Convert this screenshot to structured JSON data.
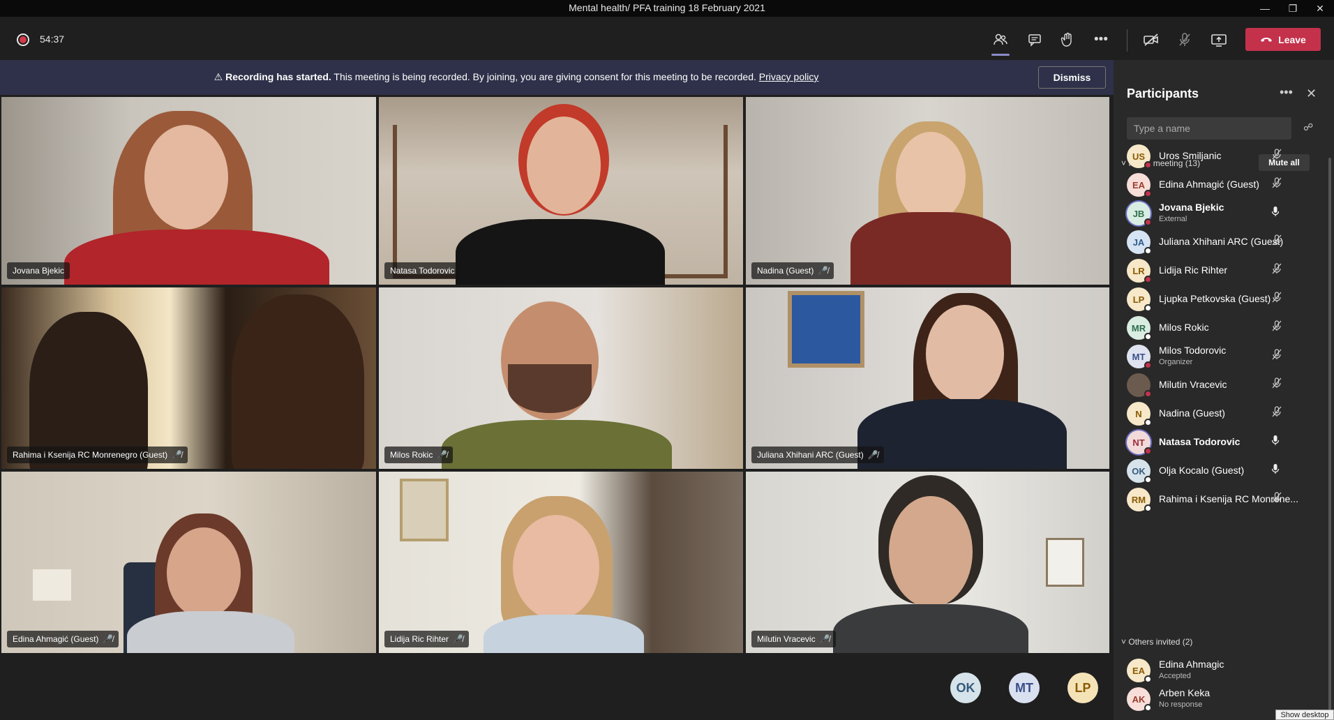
{
  "window": {
    "title": "Mental health/ PFA training 18 February 2021",
    "controls": [
      "minimize-icon",
      "restore-icon",
      "close-icon"
    ]
  },
  "toolbar": {
    "timer": "54:37",
    "icons": [
      "participants-icon",
      "chat-icon",
      "raise-hand-icon",
      "more-options-icon",
      "camera-off-icon",
      "mic-off-icon",
      "share-screen-icon"
    ],
    "leave_label": "Leave",
    "leave_color": "#c4314b"
  },
  "banner": {
    "bold_text": "Recording has started.",
    "message": "This meeting is being recorded. By joining, you are giving consent for this meeting to be recorded.",
    "link": "Privacy policy",
    "dismiss_label": "Dismiss"
  },
  "tiles": [
    {
      "name": "Jovana Bjekic",
      "muted": false
    },
    {
      "name": "Natasa Todorovic",
      "muted": false
    },
    {
      "name": "Nadina (Guest)",
      "muted": true
    },
    {
      "name": "Rahima i Ksenija RC Monrenegro (Guest)",
      "muted": true
    },
    {
      "name": "Milos Rokic",
      "muted": true
    },
    {
      "name": "Juliana Xhihani ARC (Guest)",
      "muted": true
    },
    {
      "name": "Edina Ahmagić (Guest)",
      "muted": true
    },
    {
      "name": "Lidija Ric Rihter",
      "muted": true
    },
    {
      "name": "Milutin Vracevic",
      "muted": true
    }
  ],
  "overflow_avatars": [
    {
      "initials": "OK",
      "bg": "#d6e3ea",
      "fg": "#35597a"
    },
    {
      "initials": "MT",
      "bg": "#d9e0f0",
      "fg": "#3a4f8a"
    },
    {
      "initials": "LP",
      "bg": "#f5e3b8",
      "fg": "#8a5a00"
    }
  ],
  "panel": {
    "title": "Participants",
    "search_placeholder": "Type a name",
    "in_meeting_label": "In this meeting (13)",
    "mute_all_label": "Mute all",
    "others_label": "Others invited (2)",
    "participants": [
      {
        "initials": "US",
        "name": "Uros Smiljanic",
        "sub": "",
        "mic": "off",
        "bold": false,
        "status": "#c4314b",
        "bg": "#f6e8c9",
        "fg": "#8a5a00"
      },
      {
        "initials": "EA",
        "name": "Edina Ahmagić (Guest)",
        "sub": "",
        "mic": "off",
        "bold": false,
        "status": "#c4314b",
        "bg": "#f7ded9",
        "fg": "#9a3b2c"
      },
      {
        "initials": "JB",
        "name": "Jovana Bjekic",
        "sub": "External",
        "mic": "on",
        "bold": true,
        "status": "#c4314b",
        "bg": "#d9ede3",
        "fg": "#2f6f4c"
      },
      {
        "initials": "JA",
        "name": "Juliana Xhihani ARC (Guest)",
        "sub": "",
        "mic": "off",
        "bold": false,
        "status": "#ffffff",
        "bg": "#d6e3f2",
        "fg": "#2f5a8a"
      },
      {
        "initials": "LR",
        "name": "Lidija Ric Rihter",
        "sub": "",
        "mic": "off",
        "bold": false,
        "status": "#c4314b",
        "bg": "#f6e8c9",
        "fg": "#8a5a00"
      },
      {
        "initials": "LP",
        "name": "Ljupka Petkovska (Guest)",
        "sub": "",
        "mic": "off",
        "bold": false,
        "status": "#ffffff",
        "bg": "#f6e8c9",
        "fg": "#8a5a00"
      },
      {
        "initials": "MR",
        "name": "Milos Rokic",
        "sub": "",
        "mic": "off",
        "bold": false,
        "status": "#ffffff",
        "bg": "#d9ede3",
        "fg": "#2f6f4c"
      },
      {
        "initials": "MT",
        "name": "Milos Todorovic",
        "sub": "Organizer",
        "mic": "off",
        "bold": false,
        "status": "#c4314b",
        "bg": "#dfe3f0",
        "fg": "#3a4f8a"
      },
      {
        "initials": "",
        "name": "Milutin Vracevic",
        "sub": "",
        "mic": "off",
        "bold": false,
        "status": "#c4314b",
        "bg": "#6b5a4e",
        "fg": "#ffffff"
      },
      {
        "initials": "N",
        "name": "Nadina (Guest)",
        "sub": "",
        "mic": "off",
        "bold": false,
        "status": "#ffffff",
        "bg": "#f6e8c9",
        "fg": "#8a5a00"
      },
      {
        "initials": "NT",
        "name": "Natasa Todorovic",
        "sub": "",
        "mic": "on",
        "bold": true,
        "status": "#c4314b",
        "bg": "#f2dada",
        "fg": "#9a2c3a"
      },
      {
        "initials": "OK",
        "name": "Olja Kocalo (Guest)",
        "sub": "",
        "mic": "on",
        "bold": false,
        "status": "#ffffff",
        "bg": "#d6e3ea",
        "fg": "#35597a"
      },
      {
        "initials": "RM",
        "name": "Rahima i Ksenija RC Monrene...",
        "sub": "",
        "mic": "off",
        "bold": false,
        "status": "#ffffff",
        "bg": "#f6e8c9",
        "fg": "#8a5a00"
      }
    ],
    "invited": [
      {
        "initials": "EA",
        "name": "Edina Ahmagic",
        "sub": "Accepted",
        "status": "#ffffff",
        "bg": "#f6e8c9",
        "fg": "#8a5a00"
      },
      {
        "initials": "AK",
        "name": "Arben Keka",
        "sub": "No response",
        "status": "#ffffff",
        "bg": "#f7ded9",
        "fg": "#9a3b2c"
      }
    ]
  },
  "tooltip": "Show desktop"
}
